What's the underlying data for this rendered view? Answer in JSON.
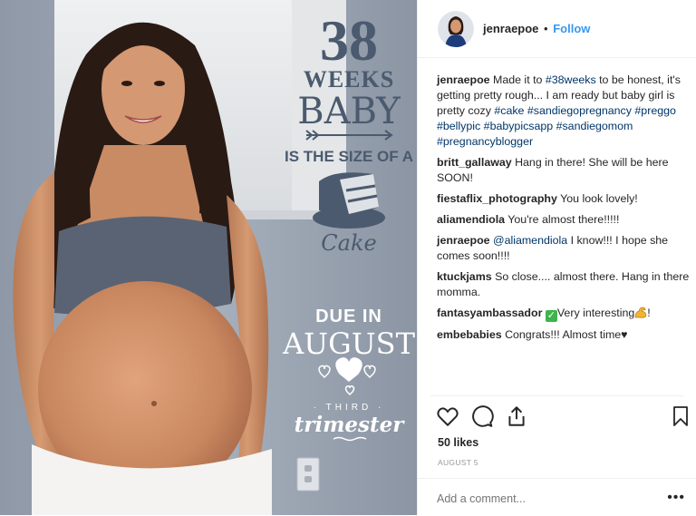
{
  "photo": {
    "week_number": "38",
    "weeks_label": "WEEKS",
    "baby_label": "BABY",
    "size_of_label": "IS THE SIZE OF A",
    "food_label": "Cake",
    "due_in_label": "DUE IN",
    "month_label": "AUGUST",
    "third_label": "THIRD",
    "trimester_label": "trimester"
  },
  "header": {
    "username": "jenraepoe",
    "separator": "•",
    "follow_label": "Follow"
  },
  "caption": {
    "user": "jenraepoe",
    "text_1": "Made it to ",
    "tag_1": "#38weeks",
    "text_2": " to be honest, it's getting pretty rough... I am ready but baby girl is pretty cozy ",
    "tag_2": "#cake",
    "tag_3": "#sandiegopregnancy",
    "tag_4": "#preggo",
    "tag_5": "#bellypic",
    "tag_6": "#babypicsapp",
    "tag_7": "#sandiegomom",
    "tag_8": "#pregnancyblogger"
  },
  "comments": [
    {
      "user": "britt_gallaway",
      "text": "Hang in there! She will be here SOON!"
    },
    {
      "user": "fiestaflix_photography",
      "text": "You look lovely!"
    },
    {
      "user": "aliamendiola",
      "text": "You're almost there!!!!!"
    },
    {
      "user": "jenraepoe",
      "mention": "@aliamendiola",
      "text": " I know!!! I hope she comes soon!!!!"
    },
    {
      "user": "ktuckjams",
      "text": "So close.... almost there. Hang in there momma."
    },
    {
      "user": "fantasyambassador",
      "check": "✓",
      "text": "Very interesting",
      "text_end": "!"
    },
    {
      "user": "embebabies",
      "text": "Congrats!!! Almost time",
      "heart": "♥"
    }
  ],
  "likes_text": "50 likes",
  "date_text": "AUGUST 5",
  "add_comment_placeholder": "Add a comment...",
  "more_label": "•••",
  "icons": {
    "like": "heart-icon",
    "comment": "comment-icon",
    "share": "share-icon",
    "save": "bookmark-icon",
    "more": "more-options-icon"
  },
  "colors": {
    "accent": "#3897f0",
    "hashtag": "#003569",
    "text": "#262626",
    "muted": "#999999",
    "wall": "#9fa8b5",
    "overlay_text": "#ffffff",
    "overlay_dark": "#4b5a6e"
  }
}
